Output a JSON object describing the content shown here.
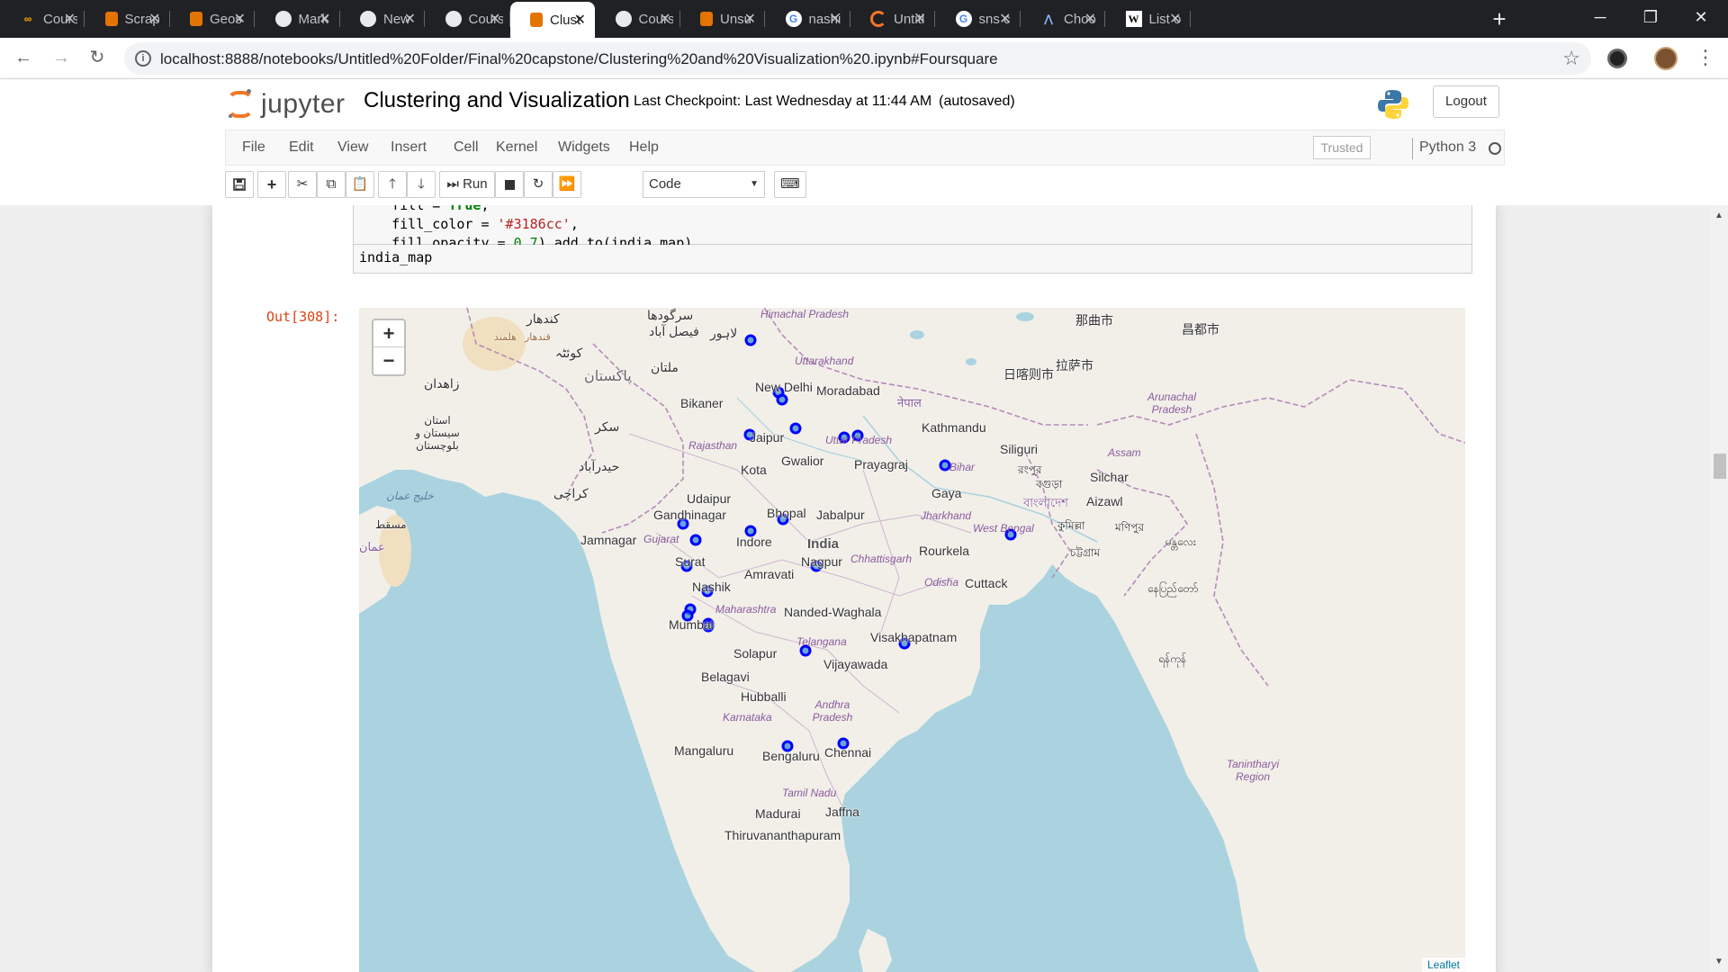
{
  "browser": {
    "tabs": [
      {
        "label": "Cours",
        "icon": "colab-icon"
      },
      {
        "label": "Scrap",
        "icon": "notebook-icon"
      },
      {
        "label": "Geos",
        "icon": "notebook-icon"
      },
      {
        "label": "Mark",
        "icon": "github-icon"
      },
      {
        "label": "New",
        "icon": "github-icon"
      },
      {
        "label": "Cours",
        "icon": "github-icon"
      },
      {
        "label": "Clust",
        "icon": "notebook-icon",
        "active": true
      },
      {
        "label": "Cours",
        "icon": "github-icon"
      },
      {
        "label": "Unsu",
        "icon": "notebook-icon"
      },
      {
        "label": "nashi",
        "icon": "google-icon"
      },
      {
        "label": "Untitl",
        "icon": "jupyter-icon"
      },
      {
        "label": "sns c",
        "icon": "google-icon"
      },
      {
        "label": "Choo",
        "icon": "anaconda-icon"
      },
      {
        "label": "List o",
        "icon": "wikipedia-icon"
      }
    ],
    "url": "localhost:8888/notebooks/Untitled%20Folder/Final%20capstone/Clustering%20and%20Visualization%20.ipynb#Foursquare"
  },
  "jupyter": {
    "logo_text": "jupyter",
    "notebook_title": "Clustering and Visualization",
    "checkpoint": "Last Checkpoint: Last Wednesday at 11:44 AM",
    "autosave": "(autosaved)",
    "logout_label": "Logout",
    "menus": [
      "File",
      "Edit",
      "View",
      "Insert",
      "Cell",
      "Kernel",
      "Widgets",
      "Help"
    ],
    "trusted_label": "Trusted",
    "kernel_name": "Python 3",
    "toolbar": {
      "run_label": "Run",
      "cell_type": "Code"
    }
  },
  "cell": {
    "code_lines": [
      {
        "pre": "    fill = ",
        "kw": "True",
        "post": ","
      },
      {
        "pre": "    fill_color = ",
        "str": "'#3186cc'",
        "post": ","
      },
      {
        "pre": "    fill_opacity = ",
        "num": "0.7",
        "post": ").add_to(india_map)"
      }
    ],
    "last_line": "india_map",
    "out_prompt": "Out[308]:"
  },
  "map": {
    "marker_color": "#0000ff",
    "attribution": "Leaflet",
    "zoom_in": "+",
    "zoom_out": "−",
    "cities": [
      "New Delhi",
      "Moradabad",
      "Bikaner",
      "Jaipur",
      "Gwalior",
      "Prayagraj",
      "Kathmandu",
      "Kota",
      "Gaya",
      "Siliguri",
      "Silchar",
      "Aizawl",
      "Udaipur",
      "Gandhinagar",
      "Jamnagar",
      "Bhopal",
      "Jabalpur",
      "India",
      "Indore",
      "Surat",
      "Nagpur",
      "Rourkela",
      "Amravati",
      "Nashik",
      "Cuttack",
      "Nanded-Waghala",
      "Mumbai",
      "Visakhapatnam",
      "Solapur",
      "Vijayawada",
      "Belagavi",
      "Hubballi",
      "Mangaluru",
      "Bengaluru",
      "Chennai",
      "Madurai",
      "Jaffna",
      "Thiruvananthapuram"
    ],
    "region_labels": [
      "Himachal Pradesh",
      "Uttarakhand",
      "Rajasthan",
      "Uttar Pradesh",
      "Bihar",
      "Jharkhand",
      "West Bengal",
      "Gujarat",
      "Chhattisgarh",
      "Odisha",
      "Maharashtra",
      "Telangana",
      "Andhra Pradesh",
      "Karnataka",
      "Tamil Nadu",
      "Assam",
      "Arunachal Pradesh",
      "Tanintharyi Region"
    ],
    "foreign_labels": [
      "کندهار",
      "هلمند",
      "قندهار",
      "کوئٹہ",
      "سرگودھا",
      "فیصل آباد",
      "لاہور",
      "ملتان",
      "پاکستان",
      "زاهدان",
      "سکر",
      "استان سیستان و بلوچستان",
      "حیدرآباد",
      "کراچی",
      "خلیج عمان",
      "مسقط",
      "عمان",
      "那曲市",
      "昌都市",
      "日喀则市",
      "拉萨市",
      "नेपाल",
      "বাংলাদেশ",
      "বগুড়া",
      "রংপুর",
      "কুমিল্লা",
      "চট্টগ্রাম",
      "মণিপুর",
      "မန္တလေး",
      "နေပြည်တော်",
      "ရန်ကုန်"
    ]
  }
}
